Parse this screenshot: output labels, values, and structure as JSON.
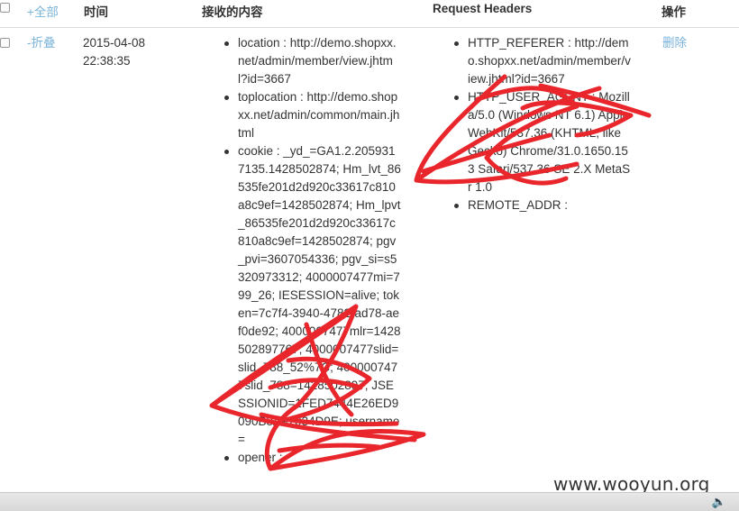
{
  "header": {
    "select_all": "+全部",
    "time": "时间",
    "content": "接收的内容",
    "request_headers": "Request Headers",
    "actions": "操作"
  },
  "row": {
    "collapse": "-折叠",
    "date": "2015-04-08",
    "time": "22:38:35",
    "content_items": [
      "location : http://demo.shopxx.net/admin/member/view.jhtml?id=3667",
      "toplocation : http://demo.shopxx.net/admin/common/main.jhtml",
      "cookie : _yd_=GA1.2.2059317135.1428502874; Hm_lvt_86535fe201d2d920c33617c810a8c9ef=1428502874; Hm_lpvt_86535fe201d2d920c33617c810a8c9ef=1428502874; pgv_pvi=3607054336; pgv_si=s5320973312; 4000007477mi=799_26; IESESSION=alive; token=7c7f4-3940-4782-ad78-aef0de92; 4000007477mlr=1428502897767; 4000007477slid=slid_788_52%7C; 4000007477slid_788=1428502897; JSESSIONID=1FED7444E26ED9090B8A97034D9E; username=",
      "opener :"
    ],
    "header_items": [
      "HTTP_REFERER : http://demo.shopxx.net/admin/member/view.jhtml?id=3667",
      "HTTP_USER_AGENT : Mozilla/5.0 (Windows NT 6.1) AppleWebKit/537.36 (KHTML, like Gecko) Chrome/31.0.1650.153 Safari/537.36 SE 2.X MetaSr 1.0",
      "REMOTE_ADDR :"
    ],
    "delete": "删除"
  },
  "watermark": "www.wooyun.org",
  "status": {
    "speaker_icon": "speaker-icon"
  },
  "colors": {
    "link": "#7ab3d9",
    "scribble": "#e8262b"
  }
}
